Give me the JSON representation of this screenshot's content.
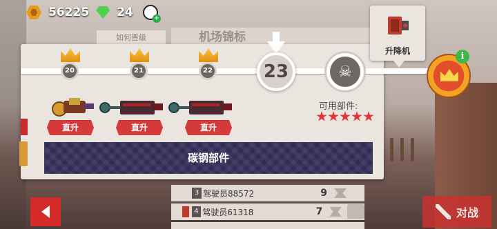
{
  "topbar": {
    "coins": "56225",
    "gems": "24",
    "coin_icon": "hex-coin-icon",
    "gem_icon": "green-gem-icon"
  },
  "background": {
    "how_to_upgrade": "如何晋级",
    "title_partial": "机场锦标"
  },
  "track": {
    "tiers": [
      {
        "number": "20",
        "reward_label": "直升"
      },
      {
        "number": "21",
        "reward_label": "直升"
      },
      {
        "number": "22",
        "reward_label": "直升"
      }
    ],
    "current_tier": "23",
    "available_parts_label": "可用部件:",
    "stars": 5,
    "carbon_parts_label": "碳钢部件"
  },
  "elevator": {
    "label": "升降机"
  },
  "league": {
    "info_symbol": "i"
  },
  "leaderboard": [
    {
      "rank": "3",
      "name": "驾驶员88572",
      "score": "9"
    },
    {
      "rank": "4",
      "name": "驾驶员61318",
      "score": "7"
    }
  ],
  "buttons": {
    "battle_label": "对战"
  },
  "colors": {
    "accent_red": "#d43a3a",
    "gold": "#e69a1e",
    "gem_green": "#4fd14c",
    "panel_bg": "#ebe5df",
    "carbon_bar": "#3a3560"
  }
}
